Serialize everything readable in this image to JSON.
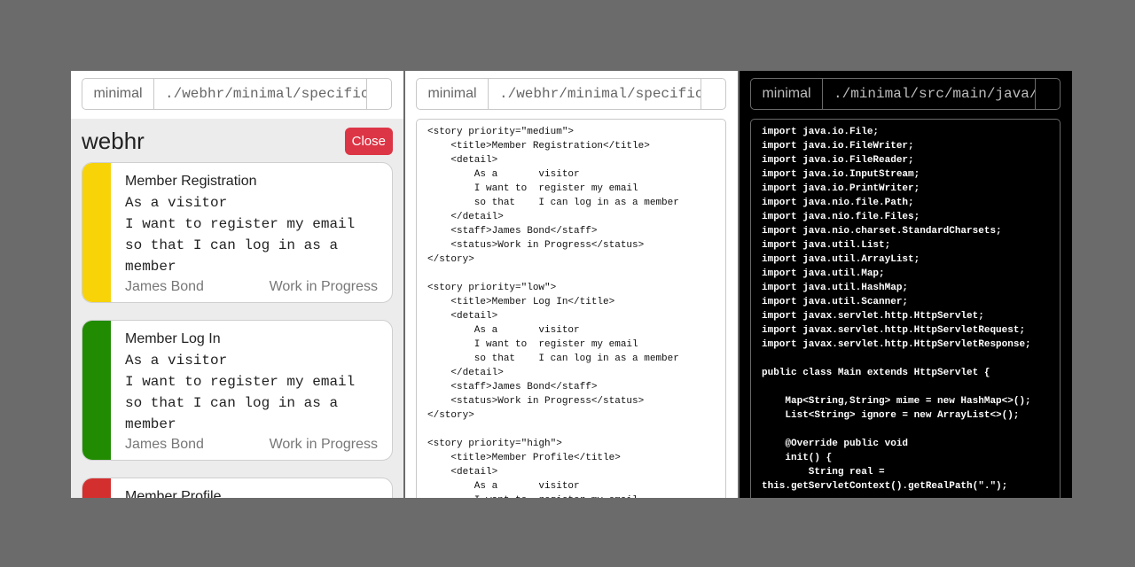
{
  "panel1": {
    "path_prefix": "minimal",
    "path_value": "./webhr/minimal/specific",
    "app_title": "webhr",
    "close_label": "Close",
    "cards": [
      {
        "title": "Member Registration",
        "lines": [
          "As a visitor",
          "I want to register my email",
          "so that I can log in as a",
          "member"
        ],
        "staff": "James Bond",
        "status": "Work in Progress",
        "color": "#f7d308"
      },
      {
        "title": "Member Log In",
        "lines": [
          "As a visitor",
          "I want to register my email",
          "so that I can log in as a",
          "member"
        ],
        "staff": "James Bond",
        "status": "Work in Progress",
        "color": "#218b02"
      },
      {
        "title": "Member Profile",
        "lines": [],
        "staff": "",
        "status": "",
        "color": "#d32f2f"
      }
    ]
  },
  "panel2": {
    "path_prefix": "minimal",
    "path_value": "./webhr/minimal/specific",
    "code": "<story priority=\"medium\">\n    <title>Member Registration</title>\n    <detail>\n        As a       visitor\n        I want to  register my email\n        so that    I can log in as a member\n    </detail>\n    <staff>James Bond</staff>\n    <status>Work in Progress</status>\n</story>\n\n<story priority=\"low\">\n    <title>Member Log In</title>\n    <detail>\n        As a       visitor\n        I want to  register my email\n        so that    I can log in as a member\n    </detail>\n    <staff>James Bond</staff>\n    <status>Work in Progress</status>\n</story>\n\n<story priority=\"high\">\n    <title>Member Profile</title>\n    <detail>\n        As a       visitor\n        I want to  register my email"
  },
  "panel3": {
    "path_prefix": "minimal",
    "path_value": "./minimal/src/main/java/",
    "code": "import java.io.File;\nimport java.io.FileWriter;\nimport java.io.FileReader;\nimport java.io.InputStream;\nimport java.io.PrintWriter;\nimport java.nio.file.Path;\nimport java.nio.file.Files;\nimport java.nio.charset.StandardCharsets;\nimport java.util.List;\nimport java.util.ArrayList;\nimport java.util.Map;\nimport java.util.HashMap;\nimport java.util.Scanner;\nimport javax.servlet.http.HttpServlet;\nimport javax.servlet.http.HttpServletRequest;\nimport javax.servlet.http.HttpServletResponse;\n\npublic class Main extends HttpServlet {\n\n    Map<String,String> mime = new HashMap<>();\n    List<String> ignore = new ArrayList<>();\n\n    @Override public void\n    init() {\n        String real =\nthis.getServletContext().getRealPath(\".\");"
  }
}
